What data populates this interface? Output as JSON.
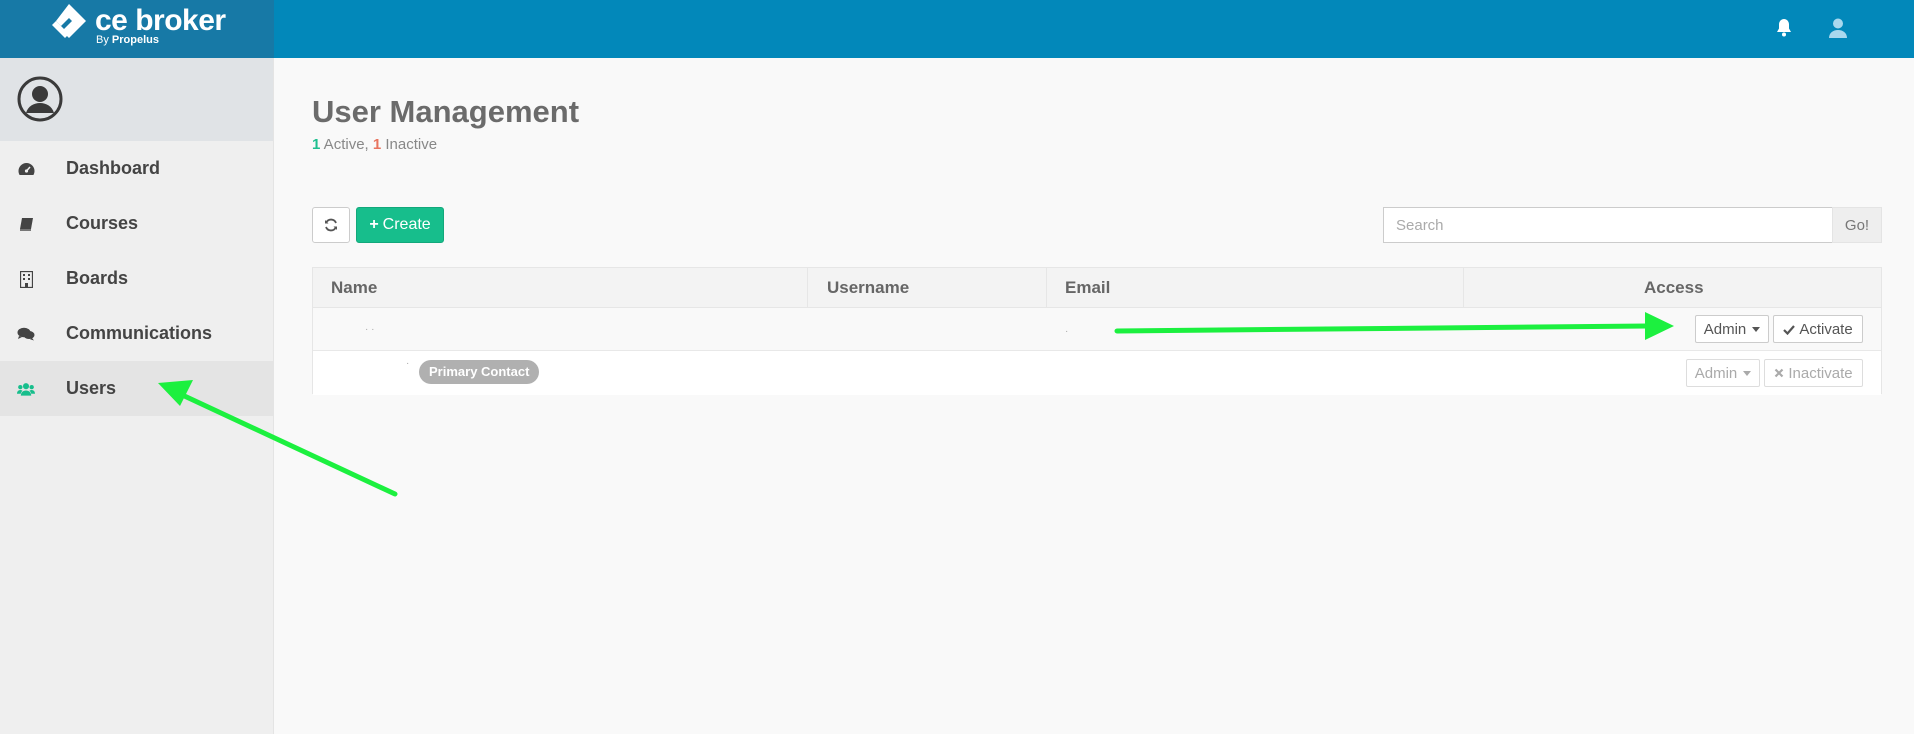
{
  "brand": {
    "name": "ce broker",
    "by": "By",
    "company": "Propelus"
  },
  "sidebar": {
    "items": [
      {
        "label": "Dashboard",
        "icon": "dashboard-icon"
      },
      {
        "label": "Courses",
        "icon": "book-icon"
      },
      {
        "label": "Boards",
        "icon": "building-icon"
      },
      {
        "label": "Communications",
        "icon": "comments-icon"
      },
      {
        "label": "Users",
        "icon": "users-icon",
        "active": true
      }
    ]
  },
  "page": {
    "title": "User Management",
    "active_count": "1",
    "active_label": " Active, ",
    "inactive_count": "1",
    "inactive_label": " Inactive"
  },
  "toolbar": {
    "create_label": "Create"
  },
  "search": {
    "placeholder": "Search",
    "go_label": "Go!"
  },
  "table": {
    "columns": [
      "Name",
      "Username",
      "Email",
      "Access"
    ],
    "rows": [
      {
        "role": "Admin",
        "action": "Activate"
      },
      {
        "badge": "Primary Contact",
        "role": "Admin",
        "action": "Inactivate"
      }
    ]
  },
  "colors": {
    "topbar": "#0288ba",
    "accent": "#17be8c",
    "arrow": "#1cf03f"
  }
}
